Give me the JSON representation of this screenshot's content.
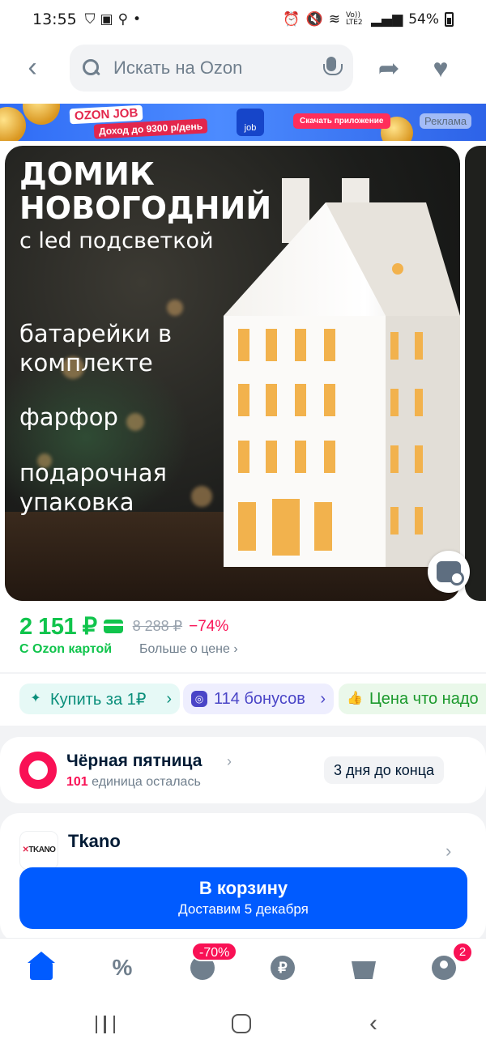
{
  "status_bar": {
    "time": "13:55",
    "battery": "54%",
    "network": "Vo)) LTE2"
  },
  "header": {
    "search_placeholder": "Искать на Ozon"
  },
  "ad_banner": {
    "title": "OZON JOB",
    "subtitle": "Доход до 9300 р/день",
    "badge_text": "job",
    "cta": "Скачать приложение",
    "label": "Реклама"
  },
  "gallery": {
    "title": "ДОМИК НОВОГОДНИЙ",
    "subtitle": "с led подсветкой",
    "feature_1": "батарейки в комплекте",
    "feature_2": "фарфор",
    "feature_3": "подарочная упаковка"
  },
  "price": {
    "current": "2 151 ₽",
    "old": "8 288 ₽",
    "discount": "−74%",
    "card_note": "С Ozon картой",
    "more_link": "Больше о цене",
    "more_link_chevron": "›"
  },
  "chips": [
    {
      "label": "Купить за 1₽",
      "icon": "sparkle-icon",
      "chevron": "›"
    },
    {
      "label": "114 бонусов",
      "icon": "bonus-icon",
      "chevron": "›"
    },
    {
      "label": "Цена что надо",
      "icon": "thumb-up-icon",
      "chevron": ""
    }
  ],
  "promo": {
    "title": "Чёрная пятница",
    "count": "101",
    "remaining_text": "единица осталась",
    "timer": "3 дня до конца"
  },
  "seller": {
    "name": "Tkano",
    "logo_text": "TKANO"
  },
  "cart_button": {
    "label": "В корзину",
    "delivery": "Доставим 5 декабря"
  },
  "bottom_nav": {
    "sale_badge": "-70%",
    "profile_badge": "2",
    "finance_glyph": "₽"
  },
  "colors": {
    "brand_blue": "#005bff",
    "price_green": "#10c44c",
    "accent_pink": "#f91155"
  }
}
